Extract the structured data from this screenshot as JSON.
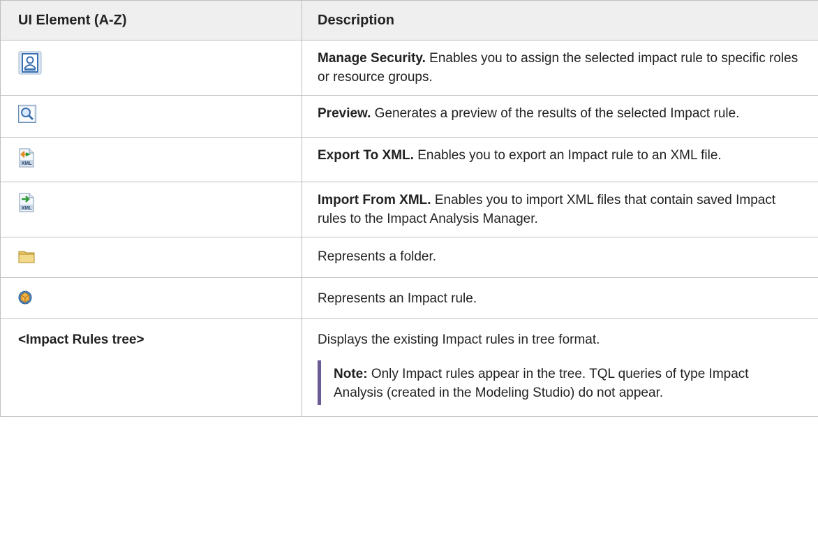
{
  "header": {
    "col1": "UI Element (A-Z)",
    "col2": "Description"
  },
  "rows": [
    {
      "icon": "manage-security-icon",
      "bold": "Manage Security.",
      "text": " Enables you to assign the selected impact rule to specific roles or resource groups."
    },
    {
      "icon": "preview-icon",
      "bold": "Preview.",
      "text": " Generates a preview of the results of the selected Impact rule."
    },
    {
      "icon": "export-xml-icon",
      "bold": "Export To XML.",
      "text": " Enables you to export an Impact rule to an XML file."
    },
    {
      "icon": "import-xml-icon",
      "bold": "Import From XML.",
      "text": " Enables you to import XML files that contain saved Impact rules to the Impact Analysis Manager."
    },
    {
      "icon": "folder-icon",
      "bold": "",
      "text": "Represents a folder."
    },
    {
      "icon": "impact-rule-icon",
      "bold": "",
      "text": "Represents an Impact rule."
    },
    {
      "label": "<Impact Rules tree>",
      "text": "Displays the existing Impact rules in tree format."
    }
  ],
  "note": {
    "label": "Note:",
    "text": "  Only Impact rules appear in the tree. TQL queries of type Impact Analysis (created in the Modeling Studio) do not appear."
  },
  "colors": {
    "header_bg": "#efefef",
    "border": "#bfbfbf",
    "note_bar": "#6b5b95"
  }
}
